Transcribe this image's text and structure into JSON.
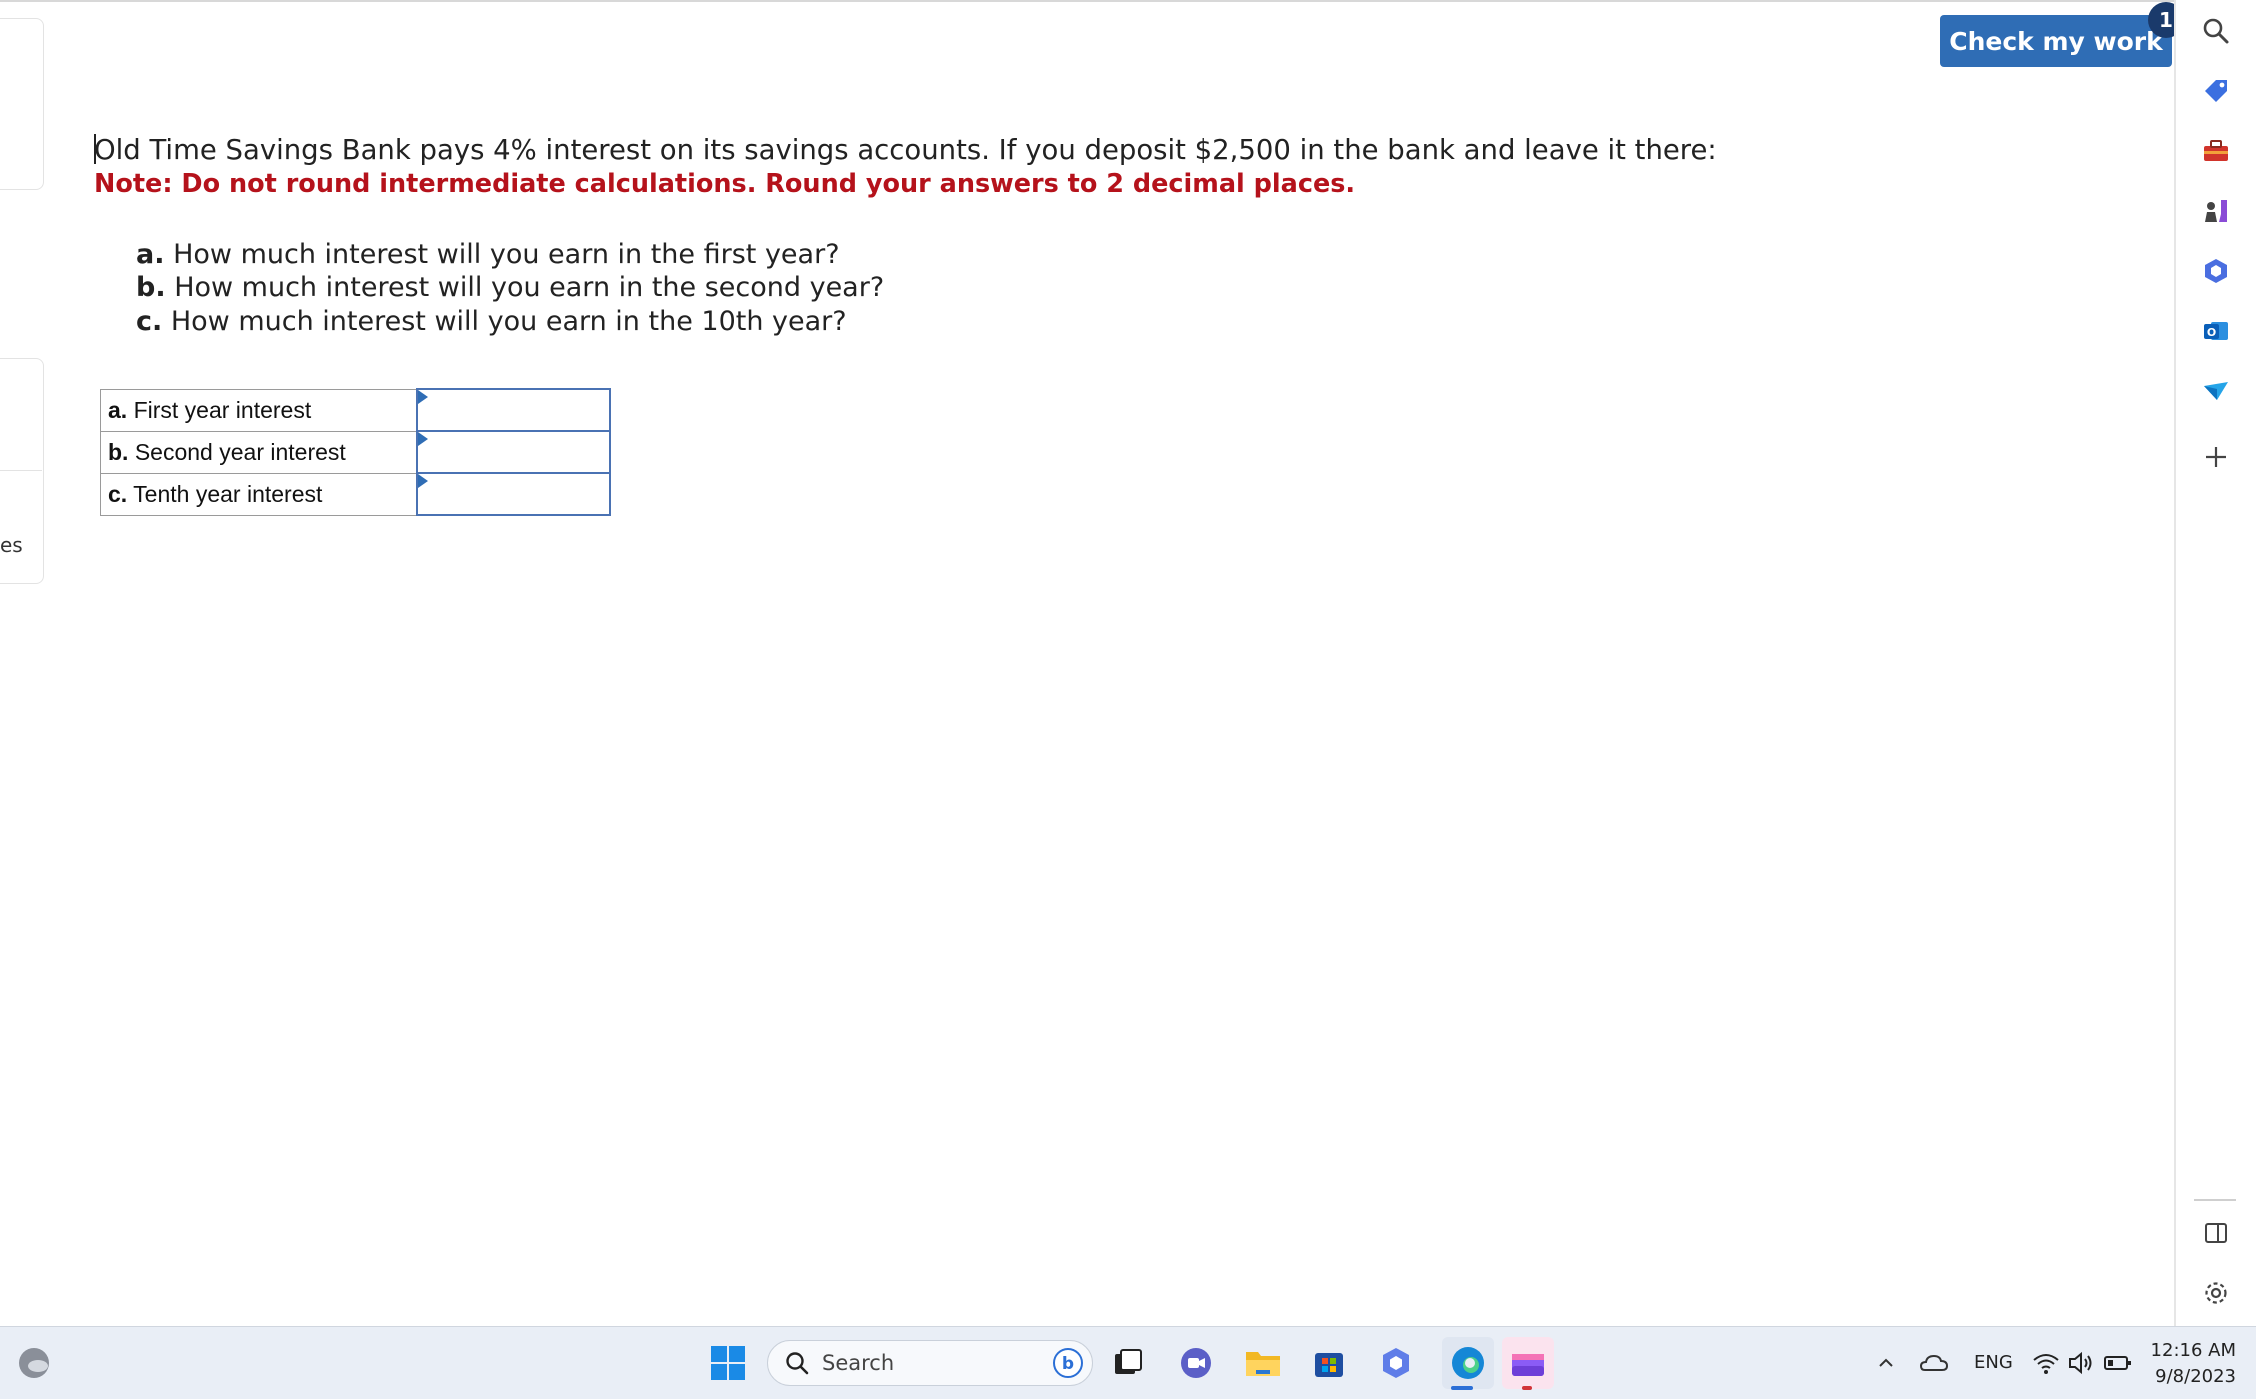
{
  "header": {
    "check_button_label": "Check my work",
    "badge_count": "1"
  },
  "left_edge": {
    "partial_label": "es"
  },
  "question": {
    "prompt": "Old Time Savings Bank pays 4% interest on its savings accounts. If you deposit $2,500 in the bank and leave it there:",
    "note": "Note: Do not round intermediate calculations. Round your answers to 2 decimal places.",
    "parts": [
      {
        "letter": "a.",
        "text": "How much interest will you earn in the first year?"
      },
      {
        "letter": "b.",
        "text": "How much interest will you earn in the second year?"
      },
      {
        "letter": "c.",
        "text": "How much interest will you earn in the 10th year?"
      }
    ]
  },
  "answer_table": {
    "rows": [
      {
        "letter": "a.",
        "label": "First year interest",
        "value": ""
      },
      {
        "letter": "b.",
        "label": "Second year interest",
        "value": ""
      },
      {
        "letter": "c.",
        "label": "Tenth year interest",
        "value": ""
      }
    ]
  },
  "sidebar": {
    "icons": [
      "search-icon",
      "tag-icon",
      "toolbox-icon",
      "chess-icon",
      "copilot-icon",
      "outlook-icon",
      "send-icon",
      "plus-icon",
      "split-view-icon",
      "settings-icon"
    ]
  },
  "taskbar": {
    "search_placeholder": "Search",
    "language": "ENG",
    "time": "12:16 AM",
    "date": "9/8/2023"
  },
  "colors": {
    "accent": "#2f6db5",
    "note_red": "#b5121b",
    "badge": "#1a3a6b"
  }
}
